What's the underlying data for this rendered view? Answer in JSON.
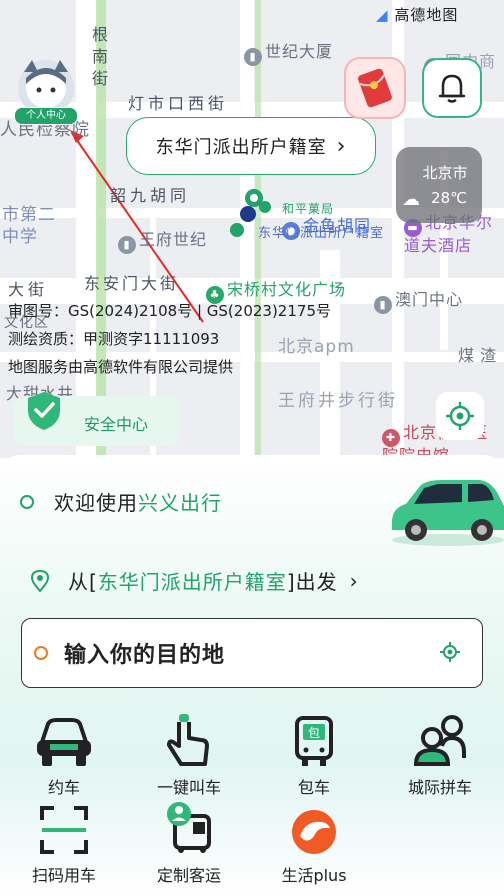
{
  "map": {
    "pois": [
      {
        "text": "世纪大厦",
        "pin": "grey"
      },
      {
        "text": "国中商",
        "pin": "grey"
      },
      {
        "text": "王府世纪",
        "pin": "grey"
      },
      {
        "text": "金鱼胡同",
        "pin": "blue"
      },
      {
        "text": "北京华尔道夫酒店",
        "pin": "purple"
      },
      {
        "text": "宋桥村文化广场",
        "pin": "green"
      },
      {
        "text": "澳门中心",
        "pin": "grey"
      },
      {
        "text": "北京apm",
        "pin": "none"
      },
      {
        "text": "王府井步行街",
        "pin": "none"
      },
      {
        "text": "北京协和医院院史馆",
        "pin": "red"
      },
      {
        "text": "煤渣",
        "pin": "none"
      },
      {
        "text": "和平菓局",
        "pin": "none"
      },
      {
        "text": "东华门派出所户籍室",
        "pin": "none"
      },
      {
        "text": "人民检察院",
        "pin": "none"
      },
      {
        "text": "市第二中学",
        "pin": "none"
      },
      {
        "text": "大甜水井",
        "pin": "none"
      },
      {
        "text": "高德地图",
        "pin": "none"
      }
    ],
    "streets": [
      "灯市口西街",
      "韶九胡同",
      "东安门大街",
      "根南街",
      "大街",
      "文化区"
    ],
    "copyright": [
      "审图号：GS(2024)2108号 | GS(2023)2175号",
      "测绘资质：甲测资字11111093",
      "地图服务由高德软件有限公司提供"
    ]
  },
  "avatar_badge": "个人中心",
  "location_bubble": {
    "text": "东华门派出所户籍室",
    "chevron": "›"
  },
  "weather": {
    "city": "北京市",
    "temp": "28℃"
  },
  "safety_center": "安全中心",
  "welcome": {
    "prefix": "欢迎使用",
    "brand": "兴义出行"
  },
  "origin": {
    "prefix": "从[",
    "place": "东华门派出所户籍室",
    "suffix": "]出发",
    "chevron": "›"
  },
  "destination_placeholder": "输入你的目的地",
  "services": [
    {
      "label": "约车",
      "icon": "car-icon"
    },
    {
      "label": "一键叫车",
      "icon": "tap-hand-icon"
    },
    {
      "label": "包车",
      "icon": "bus-icon"
    },
    {
      "label": "城际拼车",
      "icon": "group-icon"
    },
    {
      "label": "扫码用车",
      "icon": "scan-icon"
    },
    {
      "label": "定制客运",
      "icon": "custom-bus-icon"
    },
    {
      "label": "生活plus",
      "icon": "dolphin-icon"
    }
  ],
  "colors": {
    "brand": "#22a36b",
    "accent_orange": "#ee7a1c",
    "map_bg": "#eceef2",
    "road_green": "#b9e4a8"
  }
}
